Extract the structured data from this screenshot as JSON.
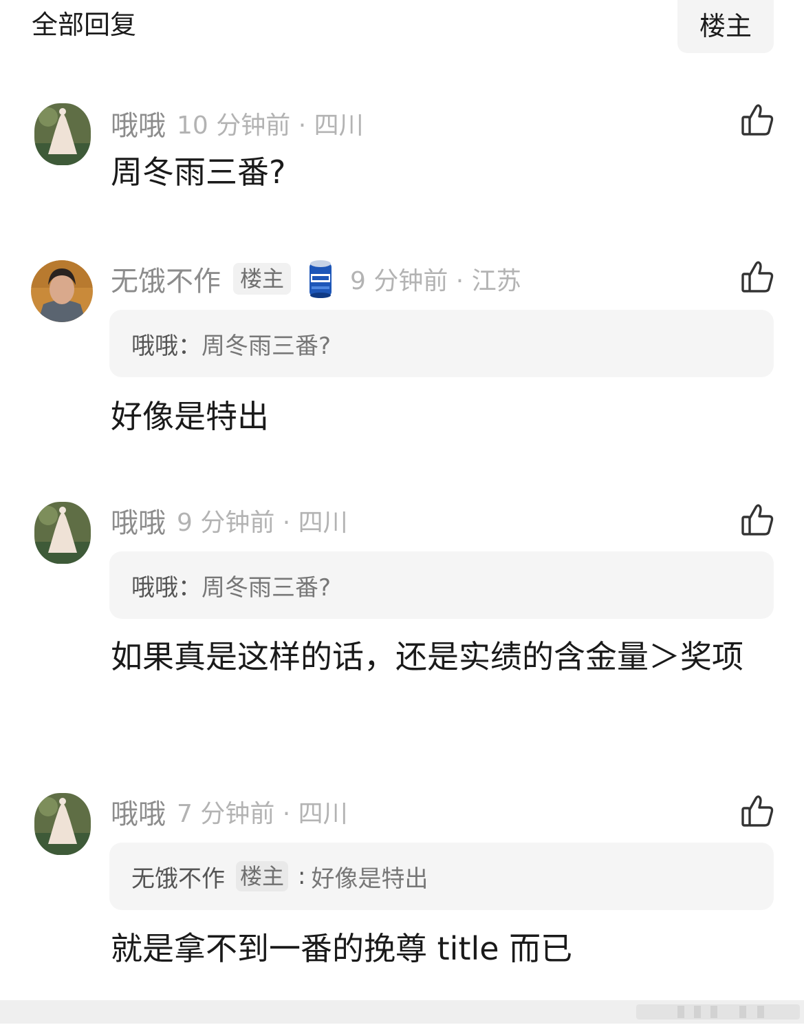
{
  "header": {
    "title": "全部回复",
    "filter_label": "楼主"
  },
  "comments": [
    {
      "username": "哦哦",
      "meta": "10 分钟前 · 四川",
      "content": "周冬雨三番?"
    },
    {
      "username": "无饿不作",
      "op_tag": "楼主",
      "badge_icon": "beer-can-icon",
      "meta": "9 分钟前 · 江苏",
      "quote": {
        "user": "哦哦：",
        "text": "周冬雨三番?"
      },
      "content": "好像是特出"
    },
    {
      "username": "哦哦",
      "meta": "9 分钟前 · 四川",
      "quote": {
        "user": "哦哦：",
        "text": "周冬雨三番?"
      },
      "content": "如果真是这样的话，还是实绩的含金量＞奖项"
    },
    {
      "username": "哦哦",
      "meta": "7 分钟前 · 四川",
      "quote": {
        "user": "无饿不作",
        "tag": "楼主",
        "sep": ":",
        "text": "好像是特出"
      },
      "content": "就是拿不到一番的挽尊 title 而已"
    }
  ],
  "colors": {
    "username": "#8c8c8c",
    "meta": "#b3b3b3",
    "quote_bg": "#f5f5f5",
    "body_text": "#1a1a1a"
  }
}
